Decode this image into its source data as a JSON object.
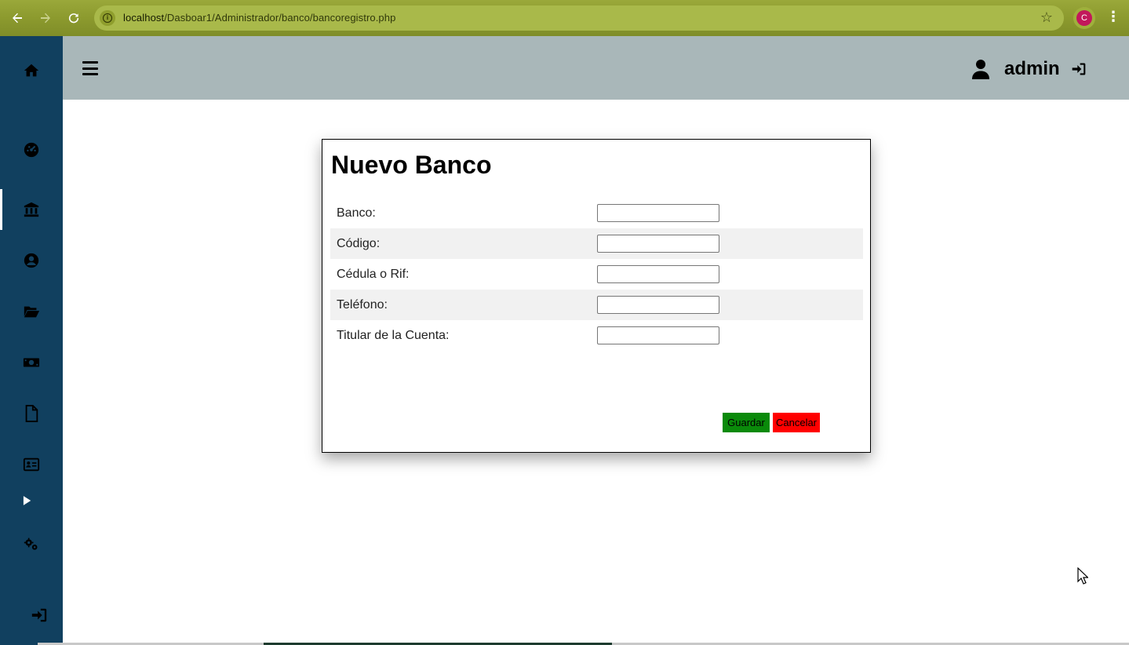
{
  "browser": {
    "url_host": "localhost",
    "url_path": "/Dasboar1/Administrador/banco/bancoregistro.php",
    "profile_initial": "C"
  },
  "header": {
    "username": "admin"
  },
  "sidebar": {
    "items": [
      {
        "icon": "home-icon"
      },
      {
        "icon": "dashboard-icon"
      },
      {
        "icon": "bank-icon",
        "active": true
      },
      {
        "icon": "user-circle-icon"
      },
      {
        "icon": "folder-open-icon"
      },
      {
        "icon": "money-icon"
      },
      {
        "icon": "file-icon"
      },
      {
        "icon": "id-card-icon"
      },
      {
        "icon": "play-icon"
      },
      {
        "icon": "gears-icon"
      },
      {
        "icon": "sign-in-icon"
      }
    ]
  },
  "form": {
    "title": "Nuevo Banco",
    "fields": [
      {
        "label": "Banco:",
        "value": ""
      },
      {
        "label": "Código:",
        "value": ""
      },
      {
        "label": "Cédula o Rif:",
        "value": ""
      },
      {
        "label": "Teléfono:",
        "value": ""
      },
      {
        "label": "Titular de la Cuenta:",
        "value": ""
      }
    ],
    "save_label": "Guardar",
    "cancel_label": "Cancelar"
  },
  "colors": {
    "sidebar_bg": "#11405f",
    "topbar_bg": "#a9b7b9",
    "save_bg": "#0a8a0a",
    "cancel_bg": "#ff0000"
  }
}
